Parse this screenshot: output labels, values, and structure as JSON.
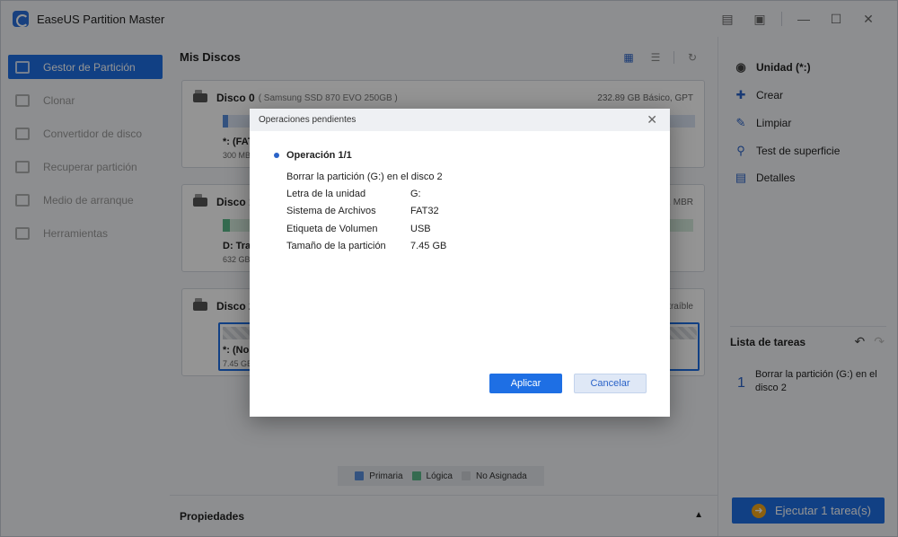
{
  "app": {
    "title": "EaseUS Partition Master",
    "window_controls": [
      "feedback-icon",
      "download-icon",
      "minimize-icon",
      "maximize-icon",
      "close-icon"
    ]
  },
  "sidebar": {
    "items": [
      {
        "label": "Gestor de Partición",
        "icon": "partition-icon",
        "active": true
      },
      {
        "label": "Clonar",
        "icon": "clone-icon",
        "active": false
      },
      {
        "label": "Convertidor de disco",
        "icon": "convert-icon",
        "active": false
      },
      {
        "label": "Recuperar partición",
        "icon": "recover-icon",
        "active": false
      },
      {
        "label": "Medio de arranque",
        "icon": "boot-media-icon",
        "active": false
      },
      {
        "label": "Herramientas",
        "icon": "tools-icon",
        "active": false
      }
    ]
  },
  "main": {
    "title": "Mis Discos",
    "disks": [
      {
        "name": "Disco 0",
        "model": "( Samsung SSD 870 EVO 250GB )",
        "info": "232.89 GB Básico, GPT",
        "partition_label": "*: (FAT",
        "partition_size": "300 MB"
      },
      {
        "name": "Disco 1",
        "model": "",
        "info": ", MBR",
        "partition_label": "D: Trab",
        "partition_size": "632 GB"
      },
      {
        "name": "Disco 2",
        "model": "",
        "info": "traíble",
        "partition_label": "*: (No",
        "partition_size": "7.45 GB"
      }
    ],
    "legend": {
      "primary": "Primaria",
      "logical": "Lógica",
      "unallocated": "No Asignada"
    },
    "properties": "Propiedades"
  },
  "right_panel": {
    "drive": "Unidad (*:)",
    "actions": [
      "Crear",
      "Limpiar",
      "Test de superficie",
      "Detalles"
    ],
    "tasks_title": "Lista de tareas",
    "task_number": "1",
    "task_text": "Borrar la partición (G:) en el disco 2",
    "execute_label": "Ejecutar 1 tarea(s)"
  },
  "modal": {
    "title": "Operaciones pendientes",
    "operation": "Operación 1/1",
    "description": "Borrar la partición (G:) en el disco 2",
    "rows": [
      {
        "key": "Letra de la unidad",
        "value": "G:"
      },
      {
        "key": "Sistema de Archivos",
        "value": "FAT32"
      },
      {
        "key": "Etiqueta de Volumen",
        "value": "USB"
      },
      {
        "key": "Tamaño de la partición",
        "value": "7.45 GB"
      }
    ],
    "apply": "Aplicar",
    "cancel": "Cancelar"
  },
  "colors": {
    "accent": "#1e6fe4",
    "primary_partition": "#5a8fdc",
    "logical_partition": "#5cb88a",
    "unallocated": "#cfd3d8"
  }
}
